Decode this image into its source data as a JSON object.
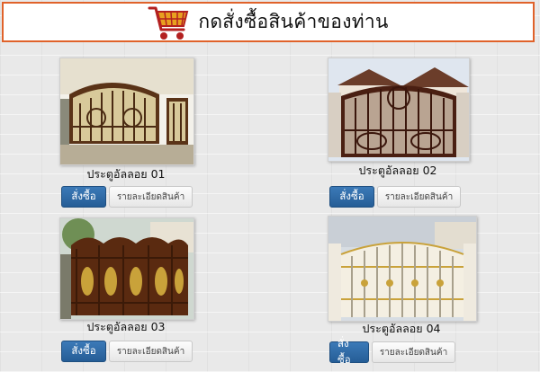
{
  "header": {
    "title": "กดสั่งซื้อสินค้าของท่าน",
    "icon": "shopping-cart-icon",
    "border_color": "#e0622a"
  },
  "products": [
    {
      "name": "ประตูอัลลอย 01",
      "buy_label": "สั่งซื้อ",
      "detail_label": "รายละเอียดสินค้า"
    },
    {
      "name": "ประตูอัลลอย 02",
      "buy_label": "สั่งซื้อ",
      "detail_label": "รายละเอียดสินค้า"
    },
    {
      "name": "ประตูอัลลอย 03",
      "buy_label": "สั่งซื้อ",
      "detail_label": "รายละเอียดสินค้า"
    },
    {
      "name": "ประตูอัลลอย 04",
      "buy_label": "สั่งซื้อ",
      "detail_label": "รายละเอียดสินค้า"
    }
  ],
  "colors": {
    "buy_button": "#2f6aa6",
    "gate_bronze": "#5a3317",
    "gate_gold": "#c9a23a"
  }
}
